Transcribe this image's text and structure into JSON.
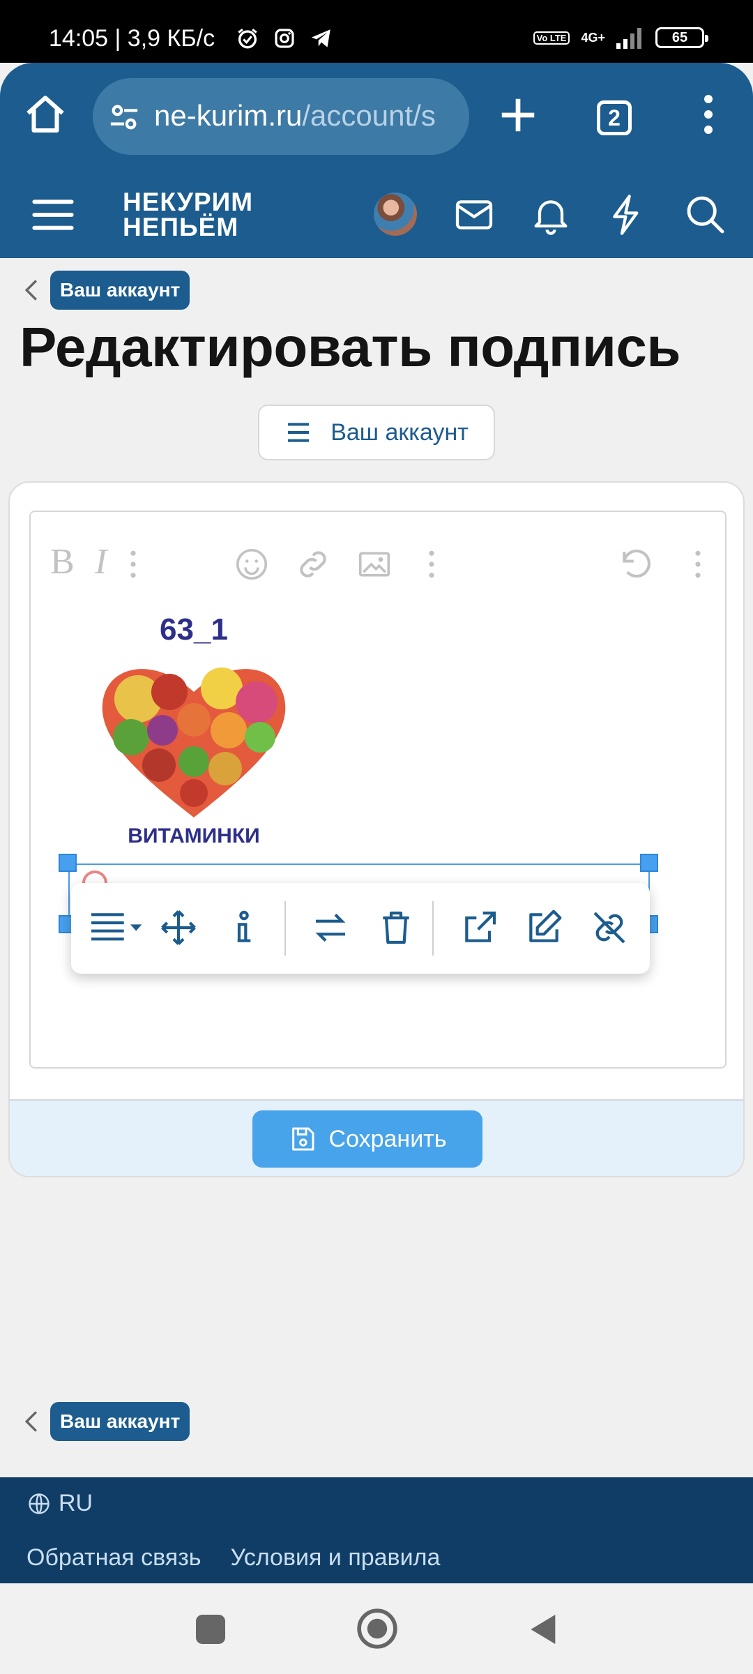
{
  "status": {
    "time": "14:05 | 3,9 КБ/с",
    "volte": "Vo LTE",
    "network": "4G+",
    "battery": "65"
  },
  "browser": {
    "url_host": "ne-kurim.ru",
    "url_path": "/account/s",
    "tab_count": "2"
  },
  "site": {
    "logo_line1": "НЕКУРИМ",
    "logo_line2": "НЕПЬЁМ"
  },
  "breadcrumb": {
    "label": "Ваш аккаунт"
  },
  "page": {
    "title": "Редактировать подпись",
    "account_menu_label": "Ваш аккаунт"
  },
  "editor": {
    "image_title": "63_1",
    "image_caption": "ВИТАМИНКИ",
    "toolbar": [
      "bold-icon",
      "italic-icon",
      "more-icon",
      "smiley-icon",
      "link-icon",
      "image-icon",
      "more-icon",
      "undo-icon",
      "more-icon"
    ],
    "image_toolbar": [
      "align-icon",
      "move-icon",
      "info-icon",
      "replace-icon",
      "delete-icon",
      "open-link-icon",
      "edit-link-icon",
      "unlink-icon"
    ]
  },
  "actions": {
    "save_label": "Сохранить"
  },
  "footer": {
    "language": "RU",
    "feedback_link": "Обратная связь",
    "terms_link": "Условия и правила"
  },
  "colors": {
    "header": "#1c5c8e",
    "accent": "#47a3ea",
    "footer": "#0f3d66"
  }
}
